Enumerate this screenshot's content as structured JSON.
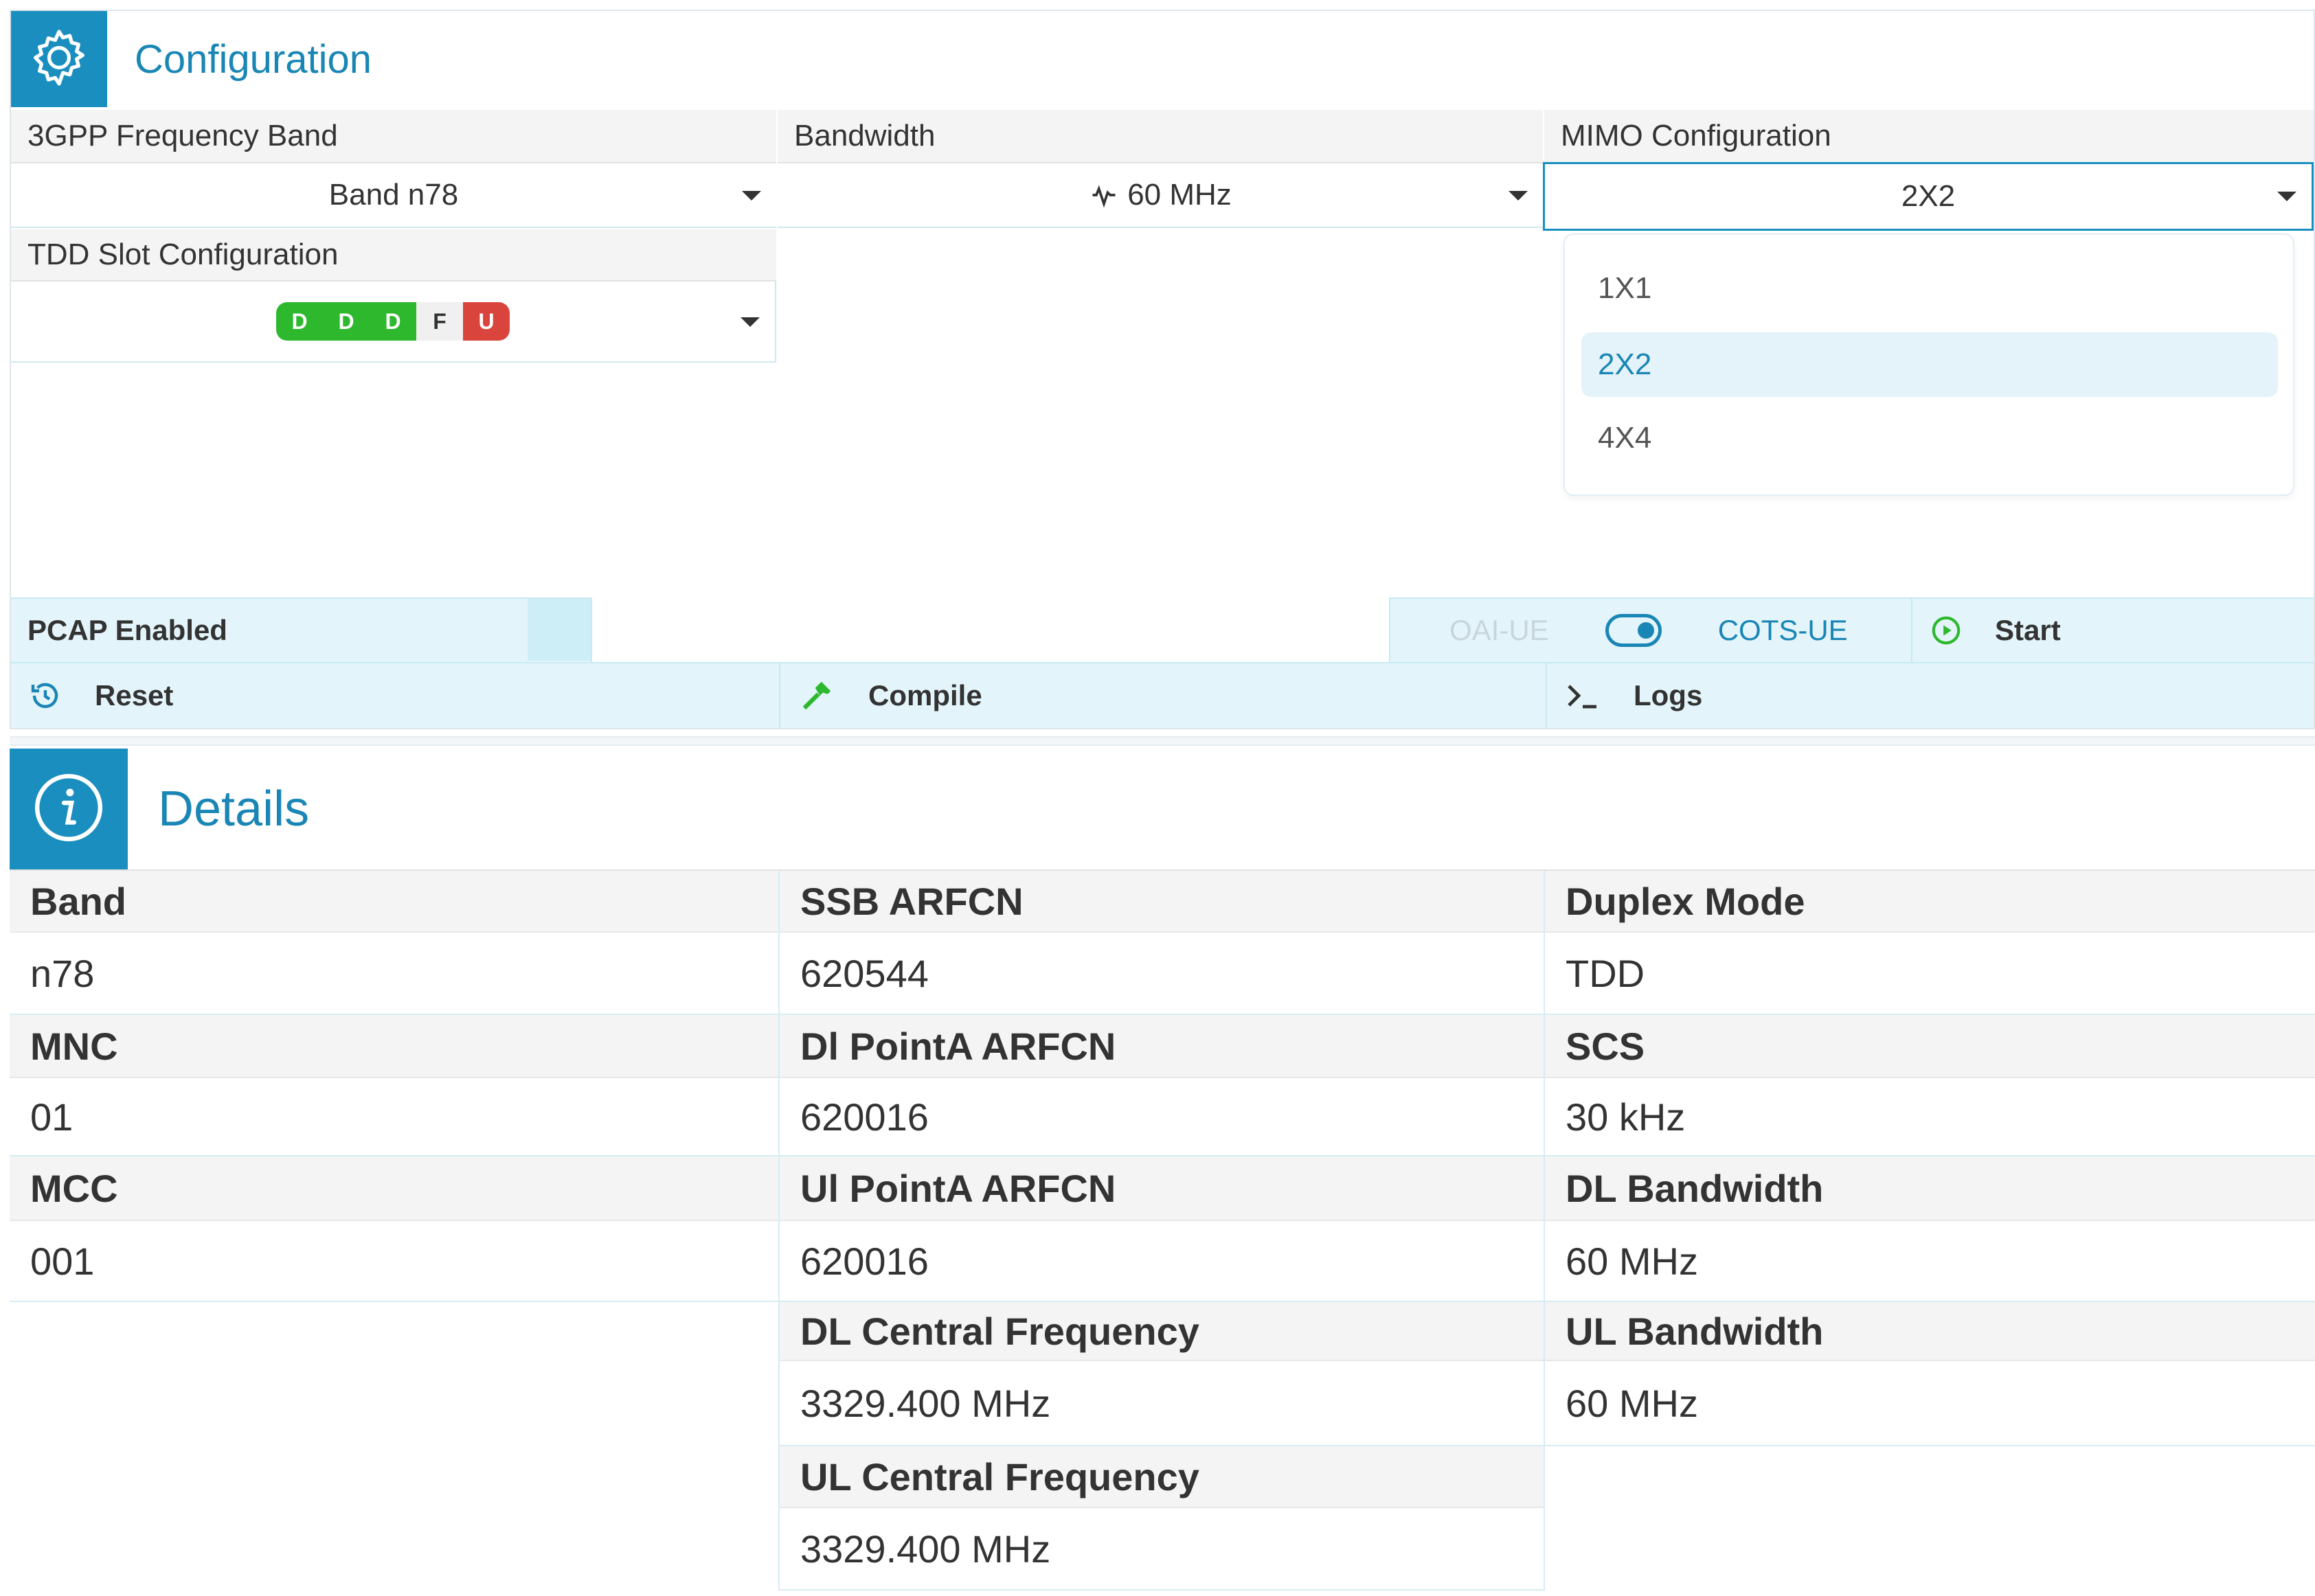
{
  "configuration": {
    "title": "Configuration",
    "icon": "gear-icon",
    "band": {
      "label": "3GPP Frequency Band",
      "value": "Band n78"
    },
    "bandwidth": {
      "label": "Bandwidth",
      "value": "60 MHz",
      "icon": "waveform-icon"
    },
    "mimo": {
      "label": "MIMO Configuration",
      "value": "2X2",
      "options": [
        "1X1",
        "2X2",
        "4X4"
      ],
      "selected": "2X2"
    },
    "tdd": {
      "label": "TDD Slot Configuration",
      "slots": [
        "D",
        "D",
        "D",
        "F",
        "U"
      ]
    },
    "pcap": {
      "label": "PCAP Enabled"
    },
    "ue_toggle": {
      "left": "OAI-UE",
      "right": "COTS-UE",
      "selected": "COTS-UE"
    },
    "buttons": {
      "start": "Start",
      "reset": "Reset",
      "compile": "Compile",
      "logs": "Logs"
    },
    "colors": {
      "accent": "#1a8fbf",
      "downlink": "#2eb82e",
      "flexible": "#f0f0f0",
      "uplink": "#d9453d"
    }
  },
  "details": {
    "title": "Details",
    "icon": "info-icon",
    "col1": [
      {
        "label": "Band",
        "value": "n78"
      },
      {
        "label": "MNC",
        "value": "01"
      },
      {
        "label": "MCC",
        "value": "001"
      }
    ],
    "col2": [
      {
        "label": "SSB ARFCN",
        "value": "620544"
      },
      {
        "label": "Dl PointA ARFCN",
        "value": "620016"
      },
      {
        "label": "Ul PointA ARFCN",
        "value": "620016"
      },
      {
        "label": "DL Central Frequency",
        "value": "3329.400 MHz"
      },
      {
        "label": "UL Central Frequency",
        "value": "3329.400 MHz"
      }
    ],
    "col3": [
      {
        "label": "Duplex Mode",
        "value": "TDD"
      },
      {
        "label": "SCS",
        "value": "30 kHz"
      },
      {
        "label": "DL Bandwidth",
        "value": "60 MHz"
      },
      {
        "label": "UL Bandwidth",
        "value": "60 MHz"
      }
    ]
  }
}
